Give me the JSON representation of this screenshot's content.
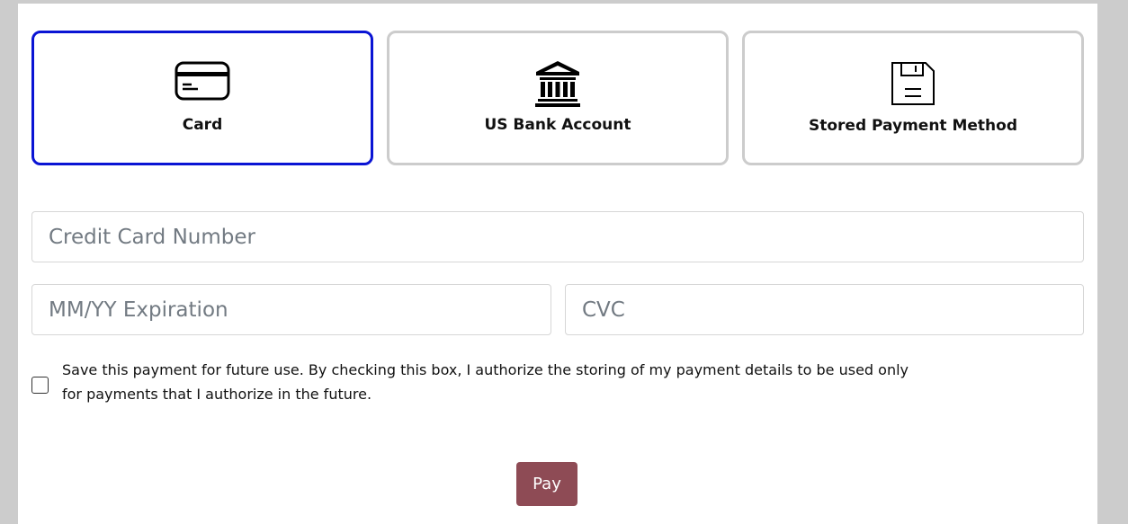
{
  "payment_methods": [
    {
      "label": "Card",
      "icon": "credit-card-icon",
      "selected": true
    },
    {
      "label": "US Bank Account",
      "icon": "bank-icon",
      "selected": false
    },
    {
      "label": "Stored Payment Method",
      "icon": "floppy-disk-icon",
      "selected": false
    }
  ],
  "form": {
    "card_number": {
      "placeholder": "Credit Card Number",
      "value": ""
    },
    "expiration": {
      "placeholder": "MM/YY Expiration",
      "value": ""
    },
    "cvc": {
      "placeholder": "CVC",
      "value": ""
    },
    "save_payment": {
      "checked": false,
      "label": "Save this payment for future use. By checking this box, I authorize the storing of my payment details to be used only for payments that I authorize in the future."
    }
  },
  "actions": {
    "pay_label": "Pay"
  },
  "colors": {
    "selected_border": "#0a14d4",
    "tile_border": "#cccccc",
    "pay_button": "#8e4b55",
    "page_background": "#cccccc"
  }
}
